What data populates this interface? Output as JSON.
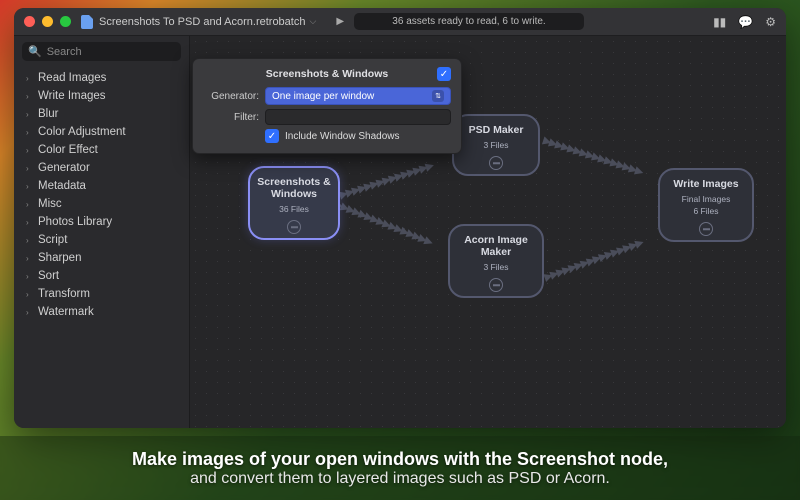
{
  "titlebar": {
    "filename": "Screenshots To PSD and Acorn.retrobatch",
    "status": "36 assets ready to read, 6 to write."
  },
  "search": {
    "placeholder": "Search"
  },
  "sidebar": {
    "items": [
      "Read Images",
      "Write Images",
      "Blur",
      "Color Adjustment",
      "Color Effect",
      "Generator",
      "Metadata",
      "Misc",
      "Photos Library",
      "Script",
      "Sharpen",
      "Sort",
      "Transform",
      "Watermark"
    ]
  },
  "inspector": {
    "title": "Screenshots & Windows",
    "generator_label": "Generator:",
    "generator_value": "One image per window",
    "filter_label": "Filter:",
    "include_shadows": "Include Window Shadows"
  },
  "nodes": {
    "screenshots": {
      "title": "Screenshots & Windows",
      "count": "36 Files"
    },
    "psd": {
      "title": "PSD Maker",
      "count": "3 Files"
    },
    "acorn": {
      "title": "Acorn Image Maker",
      "count": "3 Files"
    },
    "write": {
      "title": "Write Images",
      "sub": "Final Images",
      "count": "6 Files"
    }
  },
  "caption": {
    "line1": "Make images of your open windows with the Screenshot node,",
    "line2": "and convert them to layered images such as PSD or Acorn."
  }
}
